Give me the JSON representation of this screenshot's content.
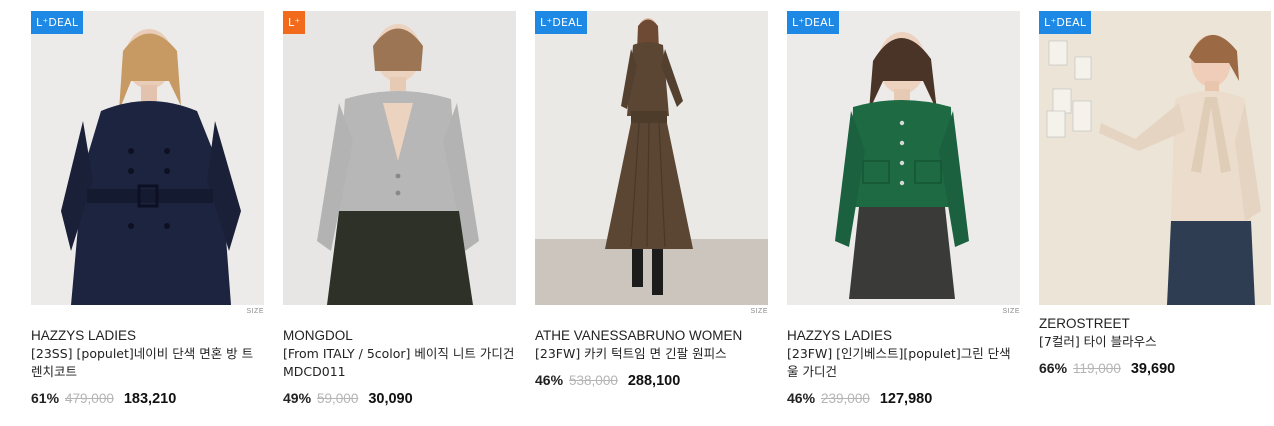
{
  "products": [
    {
      "badge": "L⁺DEAL",
      "size_tag": "SIZE",
      "brand": "HAZZYS LADIES",
      "title": "[23SS] [populet]네이비 단색 면혼 방 트렌치코트",
      "discount": "61%",
      "original_price": "479,000",
      "price": "183,210",
      "colors": {
        "bg": "#ecebe9",
        "garment": "#1d2440"
      }
    },
    {
      "badge": "L⁺",
      "size_tag": "",
      "brand": "MONGDOL",
      "title": "[From ITALY / 5color] 베이직 니트 가디건 MDCD011",
      "discount": "49%",
      "original_price": "59,000",
      "price": "30,090",
      "colors": {
        "bg": "#e7e6e4",
        "garment": "#b8b8b8"
      }
    },
    {
      "badge": "L⁺DEAL",
      "size_tag": "SIZE",
      "brand": "ATHE VANESSABRUNO WOMEN",
      "title": "[23FW] 카키 턱트임 면 긴팔 원피스",
      "discount": "46%",
      "original_price": "538,000",
      "price": "288,100",
      "colors": {
        "bg": "#ebe9e6",
        "garment": "#5a4633"
      }
    },
    {
      "badge": "L⁺DEAL",
      "size_tag": "SIZE",
      "brand": "HAZZYS LADIES",
      "title": "[23FW] [인기베스트][populet]그린 단색 울 가디건",
      "discount": "46%",
      "original_price": "239,000",
      "price": "127,980",
      "colors": {
        "bg": "#ecebea",
        "garment": "#1e6b43"
      }
    },
    {
      "badge": "L⁺DEAL",
      "size_tag": "",
      "brand": "ZEROSTREET",
      "title": "[7컬러] 타이 블라우스",
      "discount": "66%",
      "original_price": "119,000",
      "price": "39,690",
      "colors": {
        "bg": "#ece4d7",
        "garment": "#ebdccb"
      }
    }
  ]
}
